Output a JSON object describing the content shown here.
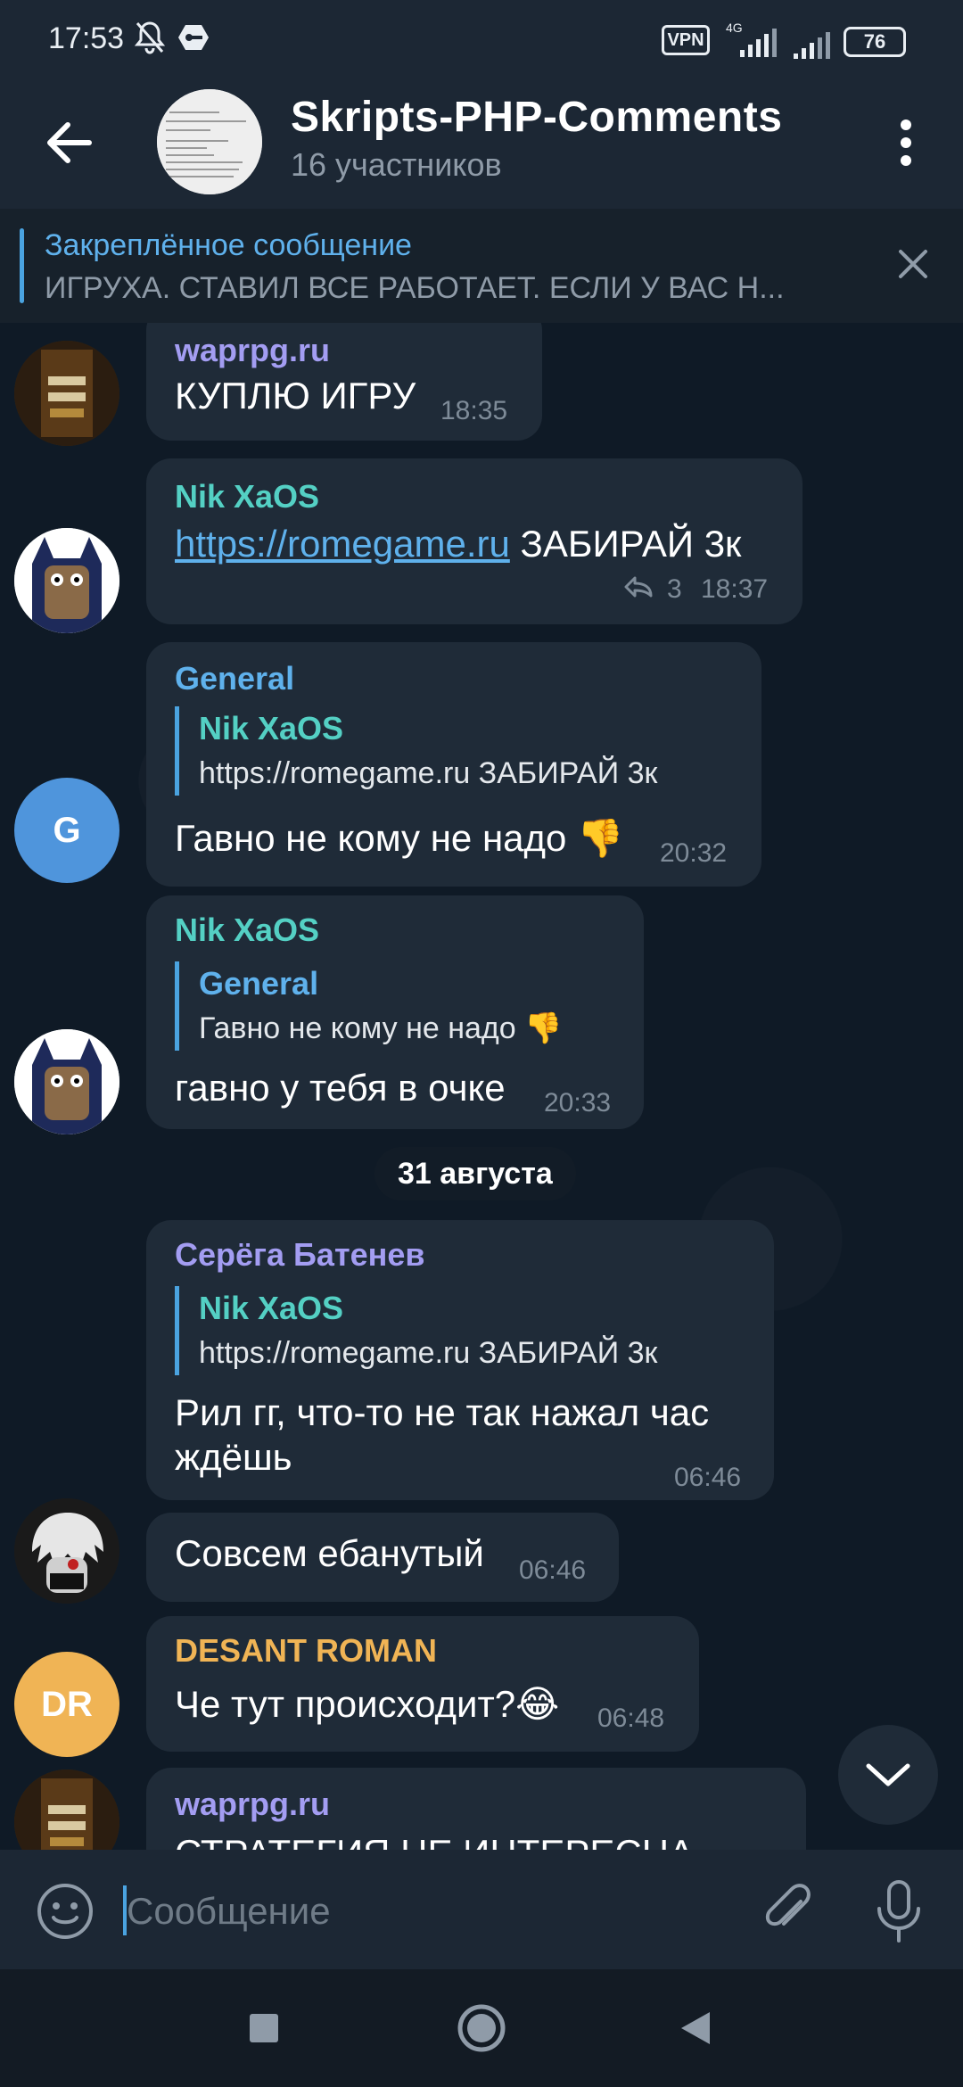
{
  "status": {
    "time": "17:53",
    "vpn": "VPN",
    "network": "4G",
    "battery": "76"
  },
  "header": {
    "title": "Skripts-PHP-Comments",
    "subtitle": "16 участников"
  },
  "pinned": {
    "title": "Закреплённое сообщение",
    "text": "ИГРУХА. СТАВИЛ ВСЕ РАБОТАЕТ. ЕСЛИ У ВАС Н..."
  },
  "messages": [
    {
      "sender": "waprpg.ru",
      "text": "КУПЛЮ ИГРУ",
      "time": "18:35"
    },
    {
      "sender": "Nik XaOS",
      "link": "https://romegame.ru",
      "text": " ЗАБИРАЙ 3к",
      "replies": "3",
      "time": "18:37"
    },
    {
      "sender": "General",
      "reply_name": "Nik XaOS",
      "reply_text": "https://romegame.ru ЗАБИРАЙ 3к",
      "text": "Гавно не кому не надо 👎",
      "time": "20:32",
      "avatar_letter": "G"
    },
    {
      "sender": "Nik XaOS",
      "reply_name": "General",
      "reply_text": "Гавно не кому не надо 👎",
      "text": "гавно у тебя в очке",
      "time": "20:33"
    },
    {
      "sender": "Серёга Батенев",
      "reply_name": "Nik XaOS",
      "reply_text": "https://romegame.ru ЗАБИРАЙ 3к",
      "text_line1": "Рил гг, что-то не так нажал час",
      "text_line2": "ждёшь",
      "time": "06:46"
    },
    {
      "text": "Совсем ебанутый",
      "time": "06:46"
    },
    {
      "sender": "DESANT ROMAN",
      "text": "Че тут происходит?😂",
      "time": "06:48",
      "avatar_letter": "DR"
    },
    {
      "sender": "waprpg.ru",
      "text": "СТРАТЕГИЯ НЕ ИНТЕРЕСНА"
    }
  ],
  "date_separator": "31 августа",
  "input": {
    "placeholder": "Сообщение"
  },
  "colors": {
    "name_purple": "#a39df2",
    "name_teal": "#54d0c4",
    "name_blue": "#5fb1ec",
    "name_orange": "#f0b455",
    "avatar_blue": "#4f95dc",
    "avatar_orange": "#f0b455",
    "bubble": "#1f2b38"
  }
}
